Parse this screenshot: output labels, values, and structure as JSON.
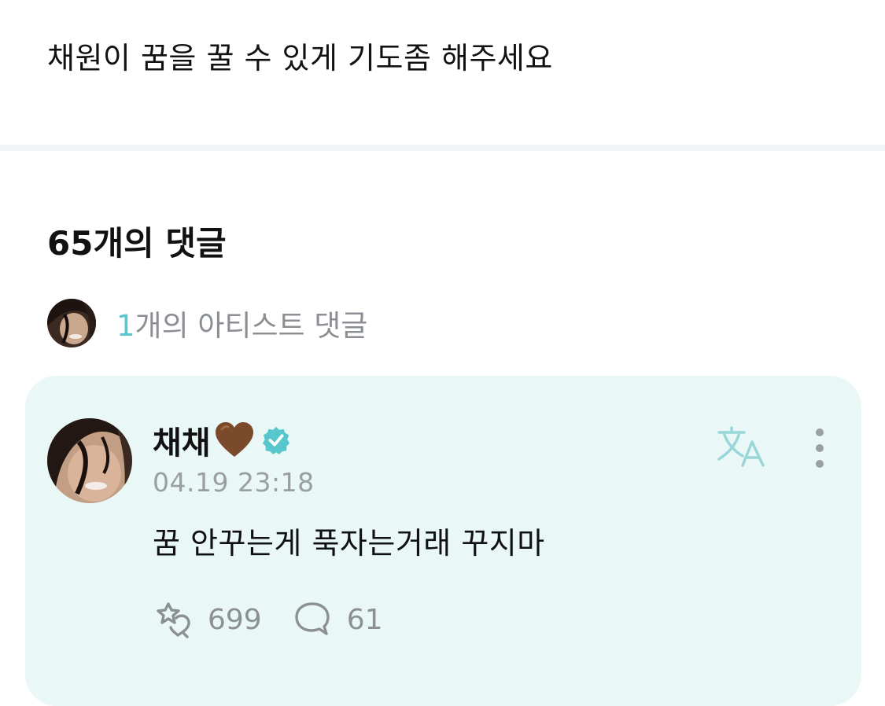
{
  "post": {
    "text": "채원이 꿈을 꿀 수 있게 기도좀 해주세요"
  },
  "comments": {
    "heading": "65개의 댓글",
    "artist_count": "1",
    "artist_label": "개의 아티스트 댓글"
  },
  "comment": {
    "author": "채채",
    "heart_color": "#7a4a2a",
    "verified_color": "#58c7cd",
    "timestamp": "04.19 23:18",
    "body": "꿈 안꾸는게 푹자는거래 꾸지마",
    "reactions": "699",
    "replies": "61"
  },
  "colors": {
    "accent": "#58c7cd",
    "card_background": "#e9f8f6",
    "muted_text": "#9a9ea3"
  },
  "icons": {
    "reaction": "sparkle-heart-icon",
    "reply": "speech-bubble-icon",
    "translate": "translate-icon",
    "more": "more-vertical-icon",
    "verified": "verified-badge-icon",
    "heart": "brown-heart-emoji"
  }
}
